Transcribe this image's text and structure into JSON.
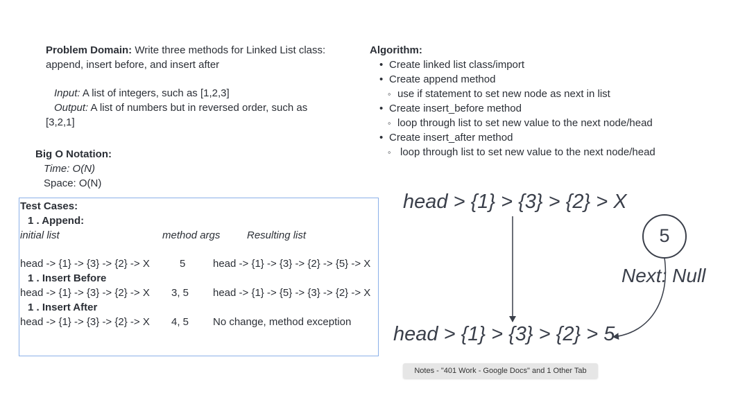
{
  "problem": {
    "label": "Problem Domain:",
    "text1": " Write three methods for Linked List class:",
    "text2": "append, insert before, and insert after",
    "input_label": "Input:",
    "input_text": " A list of integers, such as [1,2,3]",
    "output_label": "Output:",
    "output_text": "  A list of numbers but in reversed order, such      as",
    "output_text2": "[3,2,1]"
  },
  "bigo": {
    "title": "Big O Notation:",
    "time": "Time: O(N)",
    "space": "Space: O(N)"
  },
  "algorithm": {
    "title": "Algorithm:",
    "items": [
      {
        "text": "Create linked list class/import",
        "level": 1
      },
      {
        "text": "Create append method",
        "level": 1
      },
      {
        "text": "use if statement to set new node as next in list",
        "level": 2
      },
      {
        "text": "Create insert_before method",
        "level": 1
      },
      {
        "text": "loop through list to set new value to the next node/head",
        "level": 2
      },
      {
        "text": "Create insert_after method",
        "level": 1
      },
      {
        "text": "loop through list to set new value to the next node/head",
        "level": 2
      }
    ]
  },
  "tests": {
    "title": "Test Cases:",
    "append_heading": "1 . Append:",
    "col_initial": "initial list",
    "col_args": "method args",
    "col_result": "Resulting list",
    "append_row": {
      "initial": "head -> {1} -> {3} -> {2} -> X",
      "args": "5",
      "result": "head -> {1} -> {3} -> {2} -> {5} -> X"
    },
    "before_heading": "1 . Insert Before",
    "before_row": {
      "initial": "head -> {1} -> {3} -> {2} -> X",
      "args": "3, 5",
      "result": "head -> {1} -> {5} -> {3} -> {2} -> X"
    },
    "after_heading": "1 . Insert After",
    "after_row": {
      "initial": "head -> {1} -> {3} -> {2} -> X",
      "args": "4, 5",
      "result": "No change, method exception"
    }
  },
  "diagram": {
    "top_list": "head > {1} > {3} > {2} > X",
    "bottom_list": "head > {1} > {3} > {2} > 5",
    "node_value": "5",
    "next_label": "Next: Null"
  },
  "tooltip": "Notes - \"401 Work - Google Docs\" and 1 Other Tab"
}
